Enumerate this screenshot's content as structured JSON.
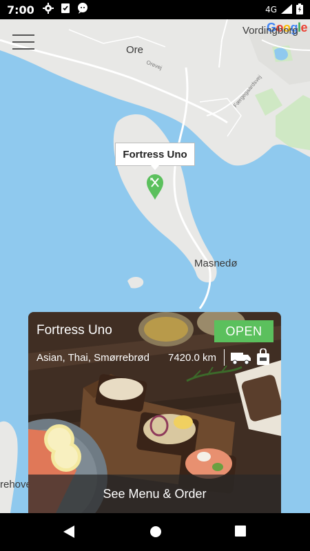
{
  "status_bar": {
    "time": "7:00",
    "network": "4G"
  },
  "map": {
    "towns": [
      "Ore",
      "Vordingborg",
      "Masnedø",
      "rehove"
    ],
    "roads": [
      "Orevej",
      "Færgegaardsvej"
    ],
    "attribution": [
      "G",
      "o",
      "o",
      "g",
      "l",
      "e"
    ],
    "colors": {
      "water": "#8fc9ee",
      "land": "#e8e8e6",
      "park": "#cfe8c4",
      "marker": "#5bc05d"
    }
  },
  "marker": {
    "info_title": "Fortress Uno",
    "icon": "fork-knife-icon"
  },
  "card": {
    "name": "Fortress Uno",
    "status": "OPEN",
    "cuisines": "Asian, Thai, Smørrebrød",
    "distance": "7420.0 km",
    "action_label": "See Menu & Order",
    "icons": [
      "delivery-truck-icon",
      "shopping-bag-icon"
    ],
    "status_color": "#5bc05d"
  },
  "nav": {
    "icons": [
      "back-icon",
      "home-icon",
      "recents-icon"
    ]
  }
}
